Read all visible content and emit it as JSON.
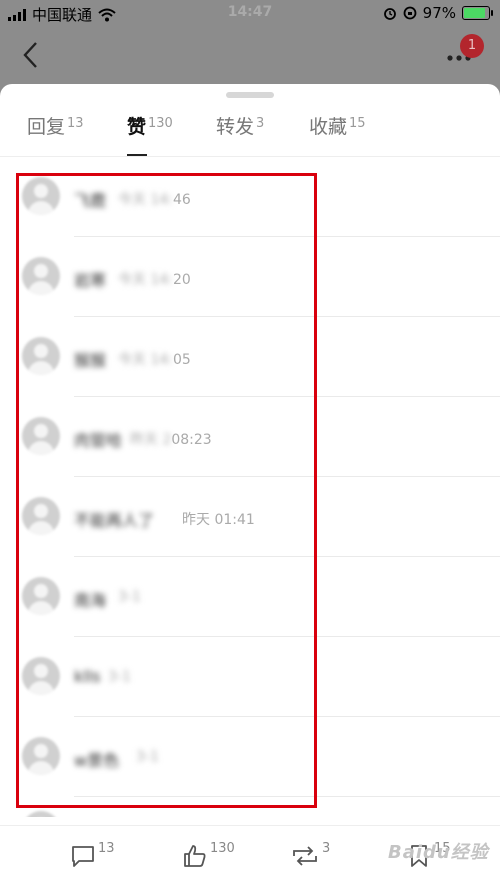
{
  "status_bar": {
    "carrier": "中国联通",
    "time": "14:47",
    "battery": "97%",
    "battery_level": 0.97
  },
  "nav": {
    "badge": "1"
  },
  "tabs": [
    {
      "label": "回复",
      "count": "13"
    },
    {
      "label": "赞",
      "count": "130"
    },
    {
      "label": "转发",
      "count": "3"
    },
    {
      "label": "收藏",
      "count": "15"
    }
  ],
  "likes": [
    {
      "name": "飞鹿",
      "time_hidden": "今天 14:",
      "time": "46"
    },
    {
      "name": "岩寒",
      "time_hidden": "今天 14:",
      "time": "20"
    },
    {
      "name": "猴猴",
      "time_hidden": "今天 14:",
      "time": "05"
    },
    {
      "name": "肉管哈",
      "time_hidden": "昨天 2",
      "time": "08:23"
    },
    {
      "name": "不能再人了",
      "time_hidden": "",
      "time": "昨天 01:41"
    },
    {
      "name": "南海",
      "time_hidden": "3-1",
      "time": ""
    },
    {
      "name": "klls",
      "time_hidden": "3-1",
      "time": ""
    },
    {
      "name": "w景色",
      "time_hidden": "3-1",
      "time": ""
    }
  ],
  "bottom_bar": {
    "comments": "13",
    "likes": "130",
    "reposts": "3",
    "favorites": "15"
  },
  "watermark": "Baidu经验",
  "colors": {
    "highlight": "#d9000d",
    "badge": "#b3262d"
  }
}
